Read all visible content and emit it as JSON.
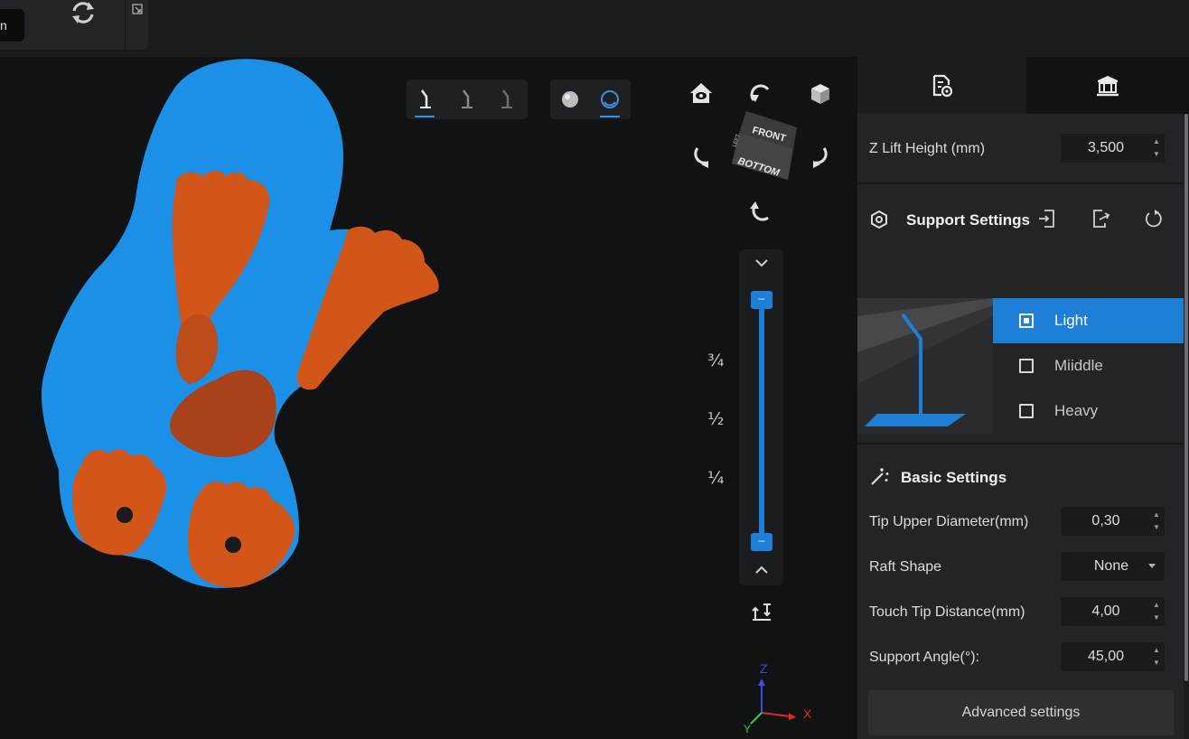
{
  "top": {
    "input_text": "n"
  },
  "panel": {
    "z_lift": {
      "label": "Z Lift Height (mm)",
      "value": "3,500"
    },
    "support": {
      "title": "Support Settings",
      "presets": [
        {
          "label": "Light",
          "selected": true
        },
        {
          "label": "Miiddle",
          "selected": false
        },
        {
          "label": "Heavy",
          "selected": false
        }
      ]
    },
    "basic": {
      "title": "Basic Settings",
      "tip_upper": {
        "label": "Tip Upper Diameter(mm)",
        "value": "0,30"
      },
      "raft_shape": {
        "label": "Raft Shape",
        "value": "None"
      },
      "touch_tip": {
        "label": "Touch Tip Distance(mm)",
        "value": "4,00"
      },
      "support_angle": {
        "label": "Support Angle(°):",
        "value": "45,00"
      }
    },
    "advanced_label": "Advanced settings"
  },
  "viewport": {
    "view_cube": {
      "front": "FRONT",
      "bottom": "BOTTOM",
      "left": "LEFT"
    },
    "slider": {
      "marks": [
        "¾",
        "½",
        "¼"
      ],
      "handle_glyph": "–",
      "lower": 0,
      "upper": 1
    },
    "axes": {
      "x": "X",
      "y": "Y",
      "z": "Z"
    }
  },
  "colors": {
    "accent": "#1e7fd6",
    "model_blue": "#1c8fe6",
    "overhang_orange": "#d2561a"
  }
}
